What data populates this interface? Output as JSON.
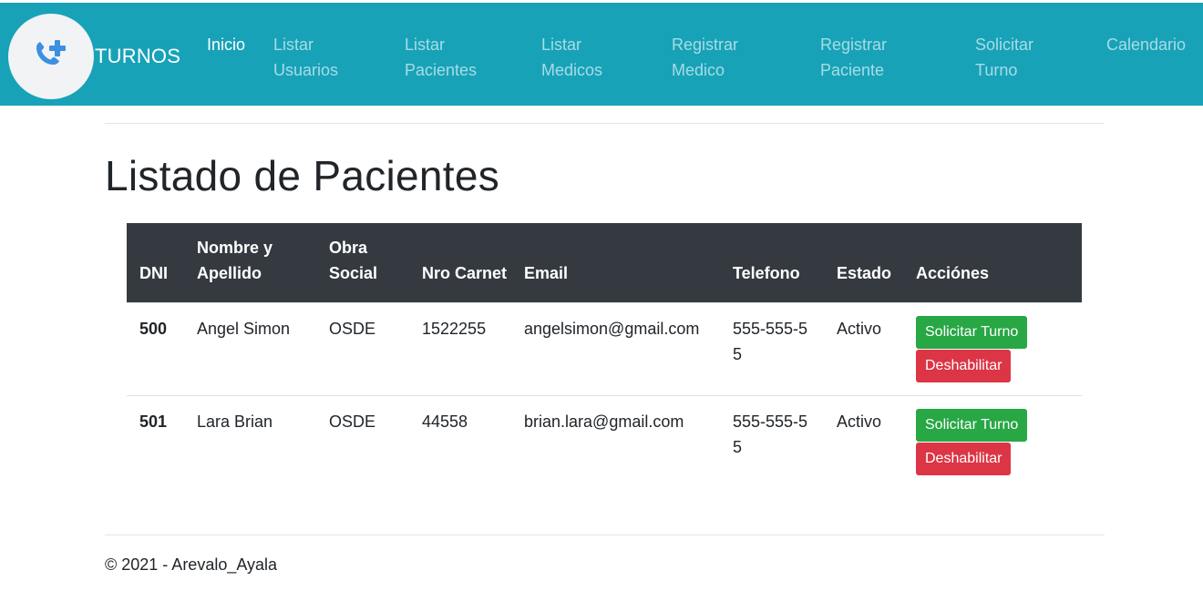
{
  "nav": {
    "brand": "TURNOS",
    "items": [
      {
        "label": "Inicio",
        "active": true
      },
      {
        "label": "Listar\nUsuarios"
      },
      {
        "label": "Listar\nPacientes"
      },
      {
        "label": "Listar\nMedicos"
      },
      {
        "label": "Registrar\nMedico"
      },
      {
        "label": "Registrar\nPaciente"
      },
      {
        "label": "Solicitar\nTurno"
      },
      {
        "label": "Calendario"
      }
    ],
    "logo_icon": "phone-plus-icon",
    "colors": {
      "navbar": "#17a2b8",
      "logo_icon": "#3d8fe0"
    }
  },
  "main": {
    "title": "Listado de Pacientes",
    "table": {
      "headers": [
        "DNI",
        "Nombre y Apellido",
        "Obra Social",
        "Nro Carnet",
        "Email",
        "Telefono",
        "Estado",
        "Acciónes"
      ],
      "rows": [
        {
          "dni": "500",
          "nombre": "Angel Simon",
          "obra_social": "OSDE",
          "nro_carnet": "1522255",
          "email": "angelsimon@gmail.com",
          "telefono": "555-555-55",
          "estado": "Activo"
        },
        {
          "dni": "501",
          "nombre": "Lara Brian",
          "obra_social": "OSDE",
          "nro_carnet": "44558",
          "email": "brian.lara@gmail.com",
          "telefono": "555-555-55",
          "estado": "Activo"
        }
      ],
      "actions": {
        "solicitar": "Solicitar Turno",
        "deshabilitar": "Deshabilitar"
      },
      "colors": {
        "header_bg": "#343a40",
        "solicitar": "#28a745",
        "deshabilitar": "#dc3545"
      }
    }
  },
  "footer": {
    "text": "© 2021 - Arevalo_Ayala"
  }
}
